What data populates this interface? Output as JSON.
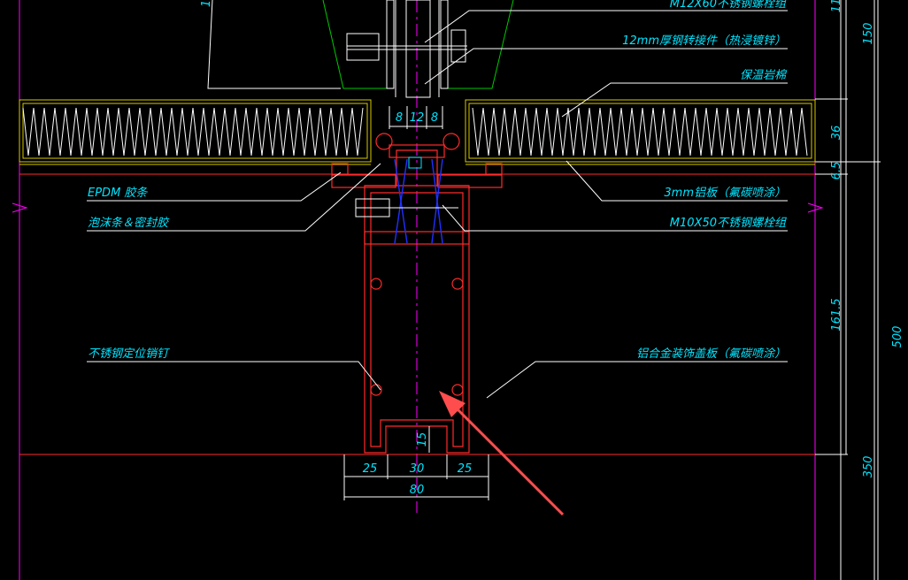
{
  "labels": {
    "bolt_top": "M12X60不锈钢螺栓组",
    "steel_connector": "12mm厚钢转接件（热浸镀锌）",
    "insulation": "保温岩棉",
    "epdm": "EPDM 胶条",
    "foam": "泡沫条＆密封胶",
    "alu_panel": "3mm铝板（氟碳喷涂）",
    "bolt_m10": "M10X50不锈钢螺栓组",
    "locating_pin": "不锈钢定位销钉",
    "cover_plate": "铝合金装饰盖板（氟碳喷涂）"
  },
  "dimensions": {
    "top_8a": "8",
    "top_12": "12",
    "top_8b": "8",
    "right_150": "150",
    "right_36": "36",
    "right_6_5": "6.5",
    "right_161_5": "161.5",
    "right_350": "350",
    "right_500": "500",
    "bot_25a": "25",
    "bot_30": "30",
    "bot_25b": "25",
    "bot_80": "80",
    "inner_15": "15",
    "cut_top_left": "1",
    "cut_top_right": "11"
  },
  "colors": {
    "text": "#00e5ff",
    "profile": "#ff2a2a",
    "connector": "#00c800",
    "axis": "#ff00ff",
    "insulation": "#d6c800",
    "arrow": "#ff4d4d"
  }
}
